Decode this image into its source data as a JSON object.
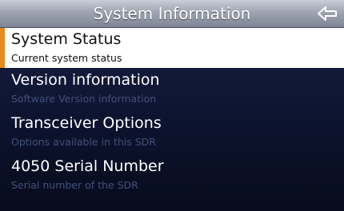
{
  "header": {
    "title": "System Information",
    "back_icon": "back-arrow-icon"
  },
  "colors": {
    "accent": "#e88a1e",
    "selected_bg": "#ffffff",
    "background": "#0d1430"
  },
  "menu": {
    "items": [
      {
        "label": "System Status",
        "description": "Current system status",
        "selected": true
      },
      {
        "label": "Version information",
        "description": "Software Version information",
        "selected": false
      },
      {
        "label": "Transceiver Options",
        "description": "Options available in this SDR",
        "selected": false
      },
      {
        "label": "4050 Serial Number",
        "description": "Serial number of the SDR",
        "selected": false
      }
    ]
  }
}
